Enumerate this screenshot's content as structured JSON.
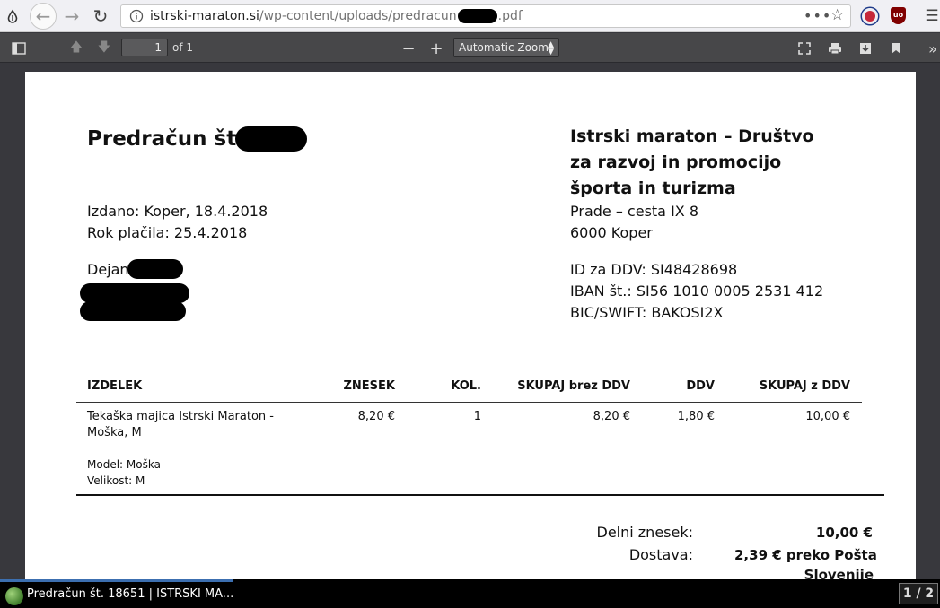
{
  "browser": {
    "url_domain": "istrski-maraton.si",
    "url_path_start": "/wp-content/uploads/predracun",
    "url_path_end": ".pdf"
  },
  "pdf_toolbar": {
    "page_number": "1",
    "page_count": "of 1",
    "zoom": "Automatic Zoom"
  },
  "invoice": {
    "title": "Predračun št.",
    "issued": "Izdano: Koper, 18.4.2018",
    "due": "Rok plačila: 25.4.2018",
    "customer_first_name": "Dejan",
    "company_name": "Istrski maraton – Društvo za razvoj in promocijo športa in turizma",
    "address_line1": "Prade – cesta IX 8",
    "address_line2": "6000 Koper",
    "vat_id": "ID za DDV: SI48428698",
    "iban": "IBAN št.: SI56 1010 0005 2531 412",
    "bic": "BIC/SWIFT: BAKOSI2X"
  },
  "table": {
    "headers": [
      "IZDELEK",
      "ZNESEK",
      "KOL.",
      "SKUPAJ brez DDV",
      "DDV",
      "SKUPAJ z DDV"
    ],
    "row": {
      "product_line1": "Tekaška majica Istrski Maraton -",
      "product_line2": "Moška, M",
      "price": "8,20 €",
      "qty": "1",
      "total_no_vat": "8,20 €",
      "vat": "1,80 €",
      "total_vat": "10,00 €",
      "model": "Model: Moška",
      "size": "Velikost: M"
    }
  },
  "summary": {
    "subtotal_label": "Delni znesek:",
    "subtotal_value": "10,00 €",
    "shipping_label": "Dostava:",
    "shipping_value_line1": "2,39 € preko Pošta",
    "shipping_value_line2": "Slovenije"
  },
  "taskbar": {
    "task_title": "Predračun št. 18651 | ISTRSKI MA...",
    "pager": "1 / 2"
  }
}
